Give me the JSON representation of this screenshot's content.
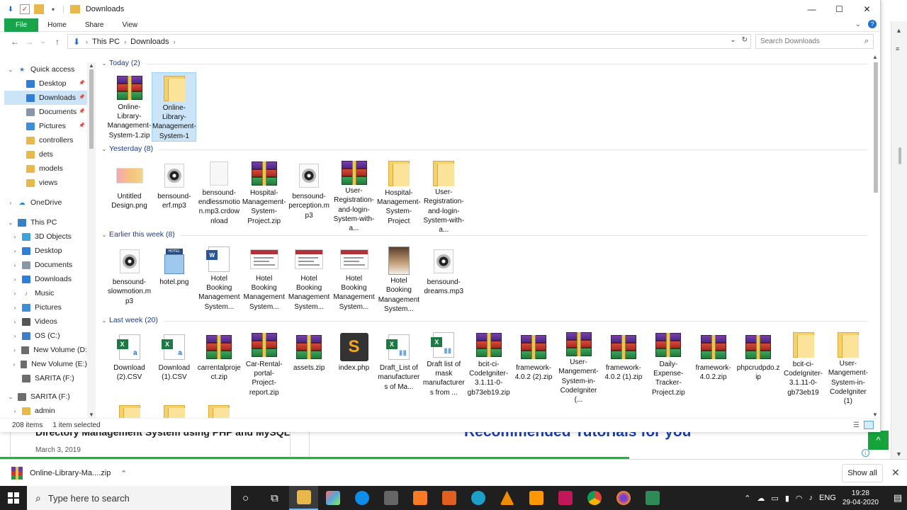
{
  "window": {
    "title": "Downloads",
    "minimize": "—",
    "maximize": "☐",
    "close": "✕"
  },
  "ribbon": {
    "tabs": [
      "File",
      "Home",
      "Share",
      "View"
    ],
    "expand": "⌄",
    "help": "?"
  },
  "address": {
    "back": "←",
    "forward": "→",
    "recent": "⌄",
    "up": "↑",
    "crumbs": [
      "This PC",
      "Downloads"
    ],
    "search_placeholder": "Search Downloads"
  },
  "nav": {
    "items": [
      {
        "label": "Quick access",
        "icon": "star-icon",
        "color": "#2f7fd8"
      },
      {
        "label": "Desktop",
        "icon": "desktop-folder-icon",
        "color": "#2f7fd8",
        "pinned": true
      },
      {
        "label": "Downloads",
        "icon": "downloads-folder-icon",
        "color": "#2f7fd8",
        "pinned": true,
        "selected": true
      },
      {
        "label": "Documents",
        "icon": "documents-folder-icon",
        "color": "#8a97a8",
        "pinned": true
      },
      {
        "label": "Pictures",
        "icon": "pictures-folder-icon",
        "color": "#3d8ed8",
        "pinned": true
      },
      {
        "label": "controllers",
        "icon": "folder-icon",
        "color": "#e8b84a"
      },
      {
        "label": "dets",
        "icon": "folder-icon",
        "color": "#e8b84a"
      },
      {
        "label": "models",
        "icon": "folder-icon",
        "color": "#e8b84a"
      },
      {
        "label": "views",
        "icon": "folder-icon",
        "color": "#e8b84a"
      },
      {
        "label": "OneDrive",
        "icon": "cloud-icon",
        "color": "#2f7fd8"
      },
      {
        "label": "This PC",
        "icon": "computer-icon",
        "color": "#3a80c9"
      },
      {
        "label": "3D Objects",
        "icon": "3d-objects-icon",
        "color": "#3fa2d8"
      },
      {
        "label": "Desktop",
        "icon": "desktop-folder-icon",
        "color": "#2f7fd8"
      },
      {
        "label": "Documents",
        "icon": "documents-folder-icon",
        "color": "#8a97a8"
      },
      {
        "label": "Downloads",
        "icon": "downloads-folder-icon",
        "color": "#2f7fd8"
      },
      {
        "label": "Music",
        "icon": "music-icon",
        "color": "#2f7fd8"
      },
      {
        "label": "Pictures",
        "icon": "pictures-folder-icon",
        "color": "#3d8ed8"
      },
      {
        "label": "Videos",
        "icon": "videos-folder-icon",
        "color": "#555555"
      },
      {
        "label": "OS (C:)",
        "icon": "drive-icon",
        "color": "#3a80c9"
      },
      {
        "label": "New Volume (D:",
        "icon": "drive-icon",
        "color": "#6d6d6d"
      },
      {
        "label": "New Volume (E:)",
        "icon": "drive-icon",
        "color": "#6d6d6d"
      },
      {
        "label": "SARITA (F:)",
        "icon": "usb-drive-icon",
        "color": "#6d6d6d"
      },
      {
        "label": "SARITA (F:)",
        "icon": "usb-drive-icon",
        "color": "#6d6d6d"
      },
      {
        "label": "admin",
        "icon": "folder-icon",
        "color": "#e8b84a"
      }
    ]
  },
  "groups": [
    {
      "title": "Today (2)",
      "items": [
        {
          "label": "Online-Library-Management-System-1.zip",
          "icon": "winrar-archive-icon"
        },
        {
          "label": "Online-Library-Management-System-1",
          "icon": "folder-icon",
          "selected": true
        }
      ]
    },
    {
      "title": "Yesterday (8)",
      "items": [
        {
          "label": "Untitled Design.png",
          "icon": "image-thumbnail-icon"
        },
        {
          "label": "bensound-erf.mp3",
          "icon": "audio-file-icon"
        },
        {
          "label": "bensound-endlessmotion.mp3.crdownload",
          "icon": "blank-file-icon"
        },
        {
          "label": "Hospital-Management-System-Project.zip",
          "icon": "winrar-archive-icon"
        },
        {
          "label": "bensound-perception.mp3",
          "icon": "audio-file-icon"
        },
        {
          "label": "User-Registration-and-login-System-with-a...",
          "icon": "winrar-archive-icon"
        },
        {
          "label": "Hospital-Management-System-Project",
          "icon": "folder-icon"
        },
        {
          "label": "User-Registration-and-login-System-with-a...",
          "icon": "folder-icon"
        }
      ]
    },
    {
      "title": "Earlier this week (8)",
      "items": [
        {
          "label": "bensound-slowmotion.mp3",
          "icon": "audio-file-icon"
        },
        {
          "label": "hotel.png",
          "icon": "hotel-image-icon"
        },
        {
          "label": "Hotel Booking Management System...",
          "icon": "word-document-icon"
        },
        {
          "label": "Hotel Booking Management System...",
          "icon": "webpage-thumbnail-icon"
        },
        {
          "label": "Hotel Booking Management System...",
          "icon": "webpage-thumbnail-icon"
        },
        {
          "label": "Hotel Booking Management System...",
          "icon": "webpage-thumbnail-icon"
        },
        {
          "label": "Hotel Booking Management System...",
          "icon": "photo-thumbnail-icon"
        },
        {
          "label": "bensound-dreams.mp3",
          "icon": "audio-file-icon"
        }
      ]
    },
    {
      "title": "Last week (20)",
      "items": [
        {
          "label": "Download (2).CSV",
          "icon": "excel-csv-icon"
        },
        {
          "label": "Download (1).CSV",
          "icon": "excel-csv-icon"
        },
        {
          "label": "carrentalproject.zip",
          "icon": "winrar-archive-icon"
        },
        {
          "label": "Car-Rental-portal-Project-report.zip",
          "icon": "winrar-archive-icon"
        },
        {
          "label": "assets.zip",
          "icon": "winrar-archive-icon"
        },
        {
          "label": "index.php",
          "icon": "sublime-file-icon"
        },
        {
          "label": "Draft_List of manufacturers of Ma...",
          "icon": "excel-chart-icon"
        },
        {
          "label": "Draft list of mask manufacturers from ...",
          "icon": "excel-chart-icon"
        },
        {
          "label": "bcit-ci-CodeIgniter-3.1.11-0-gb73eb19.zip",
          "icon": "winrar-archive-icon"
        },
        {
          "label": "framework-4.0.2 (2).zip",
          "icon": "winrar-archive-icon"
        },
        {
          "label": "User-Mangement-System-in-CodeIgniter (...",
          "icon": "winrar-archive-icon"
        },
        {
          "label": "framework-4.0.2 (1).zip",
          "icon": "winrar-archive-icon"
        },
        {
          "label": "Daily-Expense-Tracker-Project.zip",
          "icon": "winrar-archive-icon"
        },
        {
          "label": "framework-4.0.2.zip",
          "icon": "winrar-archive-icon"
        },
        {
          "label": "phpcrudpdo.zip",
          "icon": "winrar-archive-icon"
        },
        {
          "label": "bcit-ci-CodeIgniter-3.1.11-0-gb73eb19",
          "icon": "folder-icon"
        },
        {
          "label": "User-Mangement-System-in-CodeIgniter (1)",
          "icon": "folder-icon"
        },
        {
          "label": "",
          "icon": "folder-icon"
        },
        {
          "label": "",
          "icon": "folder-icon"
        },
        {
          "label": "",
          "icon": "folder-icon"
        }
      ]
    }
  ],
  "status": {
    "count": "208 items",
    "selection": "1 item selected"
  },
  "background_page": {
    "title": "Directory Management System using PHP and MySQL",
    "date": "March 3, 2019",
    "recommended": "Recommended Tutorials for you",
    "green_button": "^"
  },
  "download_bar": {
    "file": "Online-Library-Ma....zip",
    "show_all": "Show all",
    "close": "✕",
    "progress": 0.694
  },
  "taskbar": {
    "search_placeholder": "Type here to search",
    "lang": "ENG",
    "time": "19:28",
    "date": "29-04-2020"
  }
}
